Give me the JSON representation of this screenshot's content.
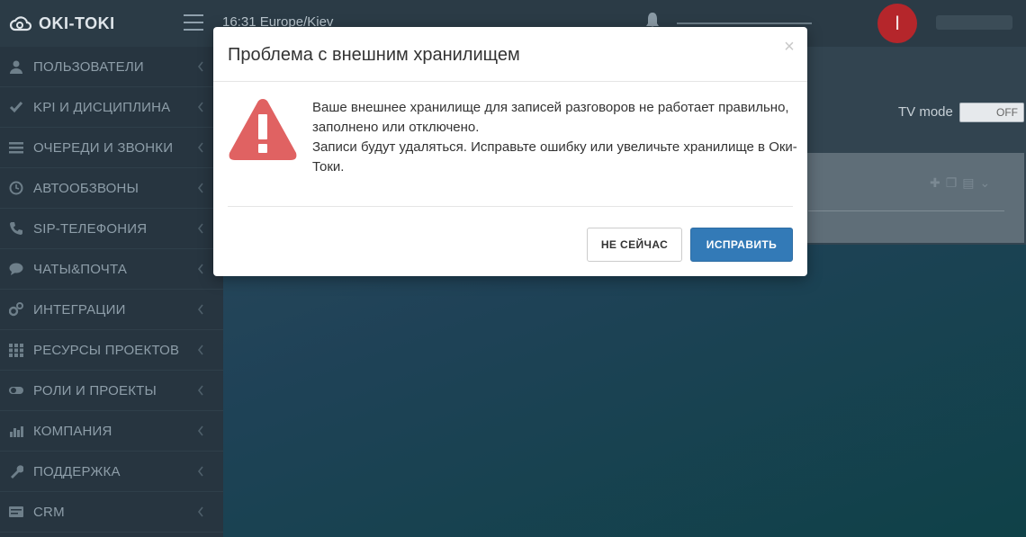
{
  "app": {
    "logo_text": "OKI-TOKI",
    "clock": "16:31  Europe/Kiev",
    "user_initial": "I"
  },
  "sidebar": {
    "items": [
      {
        "label": "ПОЛЬЗОВАТЕЛИ",
        "icon": "user-icon"
      },
      {
        "label": "KPI И ДИСЦИПЛИНА",
        "icon": "check-icon"
      },
      {
        "label": "ОЧЕРЕДИ И ЗВОНКИ",
        "icon": "list-icon"
      },
      {
        "label": "АВТООБЗВОНЫ",
        "icon": "clock-icon"
      },
      {
        "label": "SIP-ТЕЛЕФОНИЯ",
        "icon": "phone-icon"
      },
      {
        "label": "ЧАТЫ&ПОЧТА",
        "icon": "chat-icon"
      },
      {
        "label": "ИНТЕГРАЦИИ",
        "icon": "gears-icon"
      },
      {
        "label": "РЕСУРСЫ ПРОЕКТОВ",
        "icon": "grid-icon"
      },
      {
        "label": "РОЛИ И ПРОЕКТЫ",
        "icon": "toggle-icon"
      },
      {
        "label": "КОМПАНИЯ",
        "icon": "bar-chart-icon"
      },
      {
        "label": "ПОДДЕРЖКА",
        "icon": "wrench-icon"
      },
      {
        "label": "CRM",
        "icon": "card-icon"
      }
    ]
  },
  "main": {
    "tv_mode_label": "TV mode",
    "tv_toggle_label": "OFF"
  },
  "modal": {
    "title": "Проблема с внешним хранилищем",
    "message_line1": "Ваше внешнее хранилище для записей разговоров не работает правильно, заполнено или отключено.",
    "message_line2": "Записи будут удаляться. Исправьте ошибку или увеличьте хранилище в Оки-Токи.",
    "close_glyph": "×",
    "secondary_button": "НЕ СЕЙЧАС",
    "primary_button": "ИСПРАВИТЬ"
  },
  "colors": {
    "warning_red": "#e06262",
    "primary_blue": "#337ab7",
    "sidebar_bg": "#273540"
  }
}
